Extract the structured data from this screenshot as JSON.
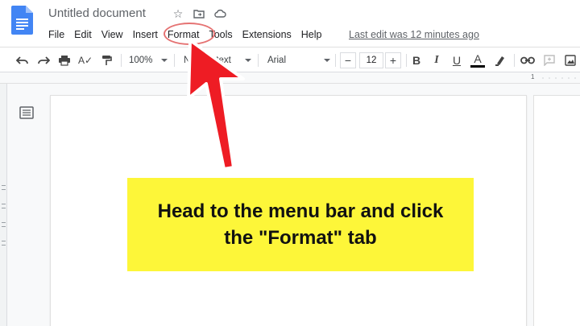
{
  "title": "Untitled document",
  "menu": [
    "File",
    "Edit",
    "View",
    "Insert",
    "Format",
    "Tools",
    "Extensions",
    "Help"
  ],
  "last_edit": "Last edit was 12 minutes ago",
  "toolbar": {
    "zoom": "100%",
    "style": "Normal text",
    "font": "Arial",
    "font_size": "12",
    "minus": "−",
    "plus": "+",
    "bold": "B",
    "italic": "I",
    "underline": "U",
    "text_color": "A"
  },
  "ruler": {
    "number": "1"
  },
  "callout": {
    "line1": "Head to the menu bar and click",
    "line2": "the \"Format\" tab"
  },
  "colors": {
    "callout_bg": "#fdf639",
    "arrow": "#ee1c24",
    "docs_blue": "#4285f4"
  }
}
